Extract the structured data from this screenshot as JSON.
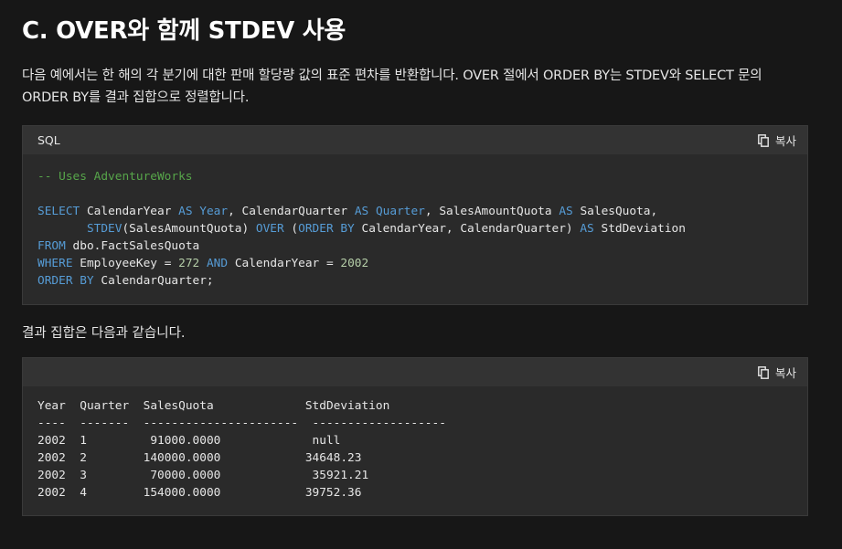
{
  "heading": "C. OVER와 함께 STDEV 사용",
  "description": "다음 예에서는 한 해의 각 분기에 대한 판매 할당량 값의 표준 편차를 반환합니다. OVER 절에서 ORDER BY는 STDEV와 SELECT 문의 ORDER BY를 결과 집합으로 정렬합니다.",
  "sql_block": {
    "language": "SQL",
    "copy_label": "복사",
    "comment": "-- Uses AdventureWorks",
    "line1": {
      "select": "SELECT",
      "col1": "CalendarYear",
      "as1": "AS",
      "alias1": "Year",
      "col2": "CalendarQuarter",
      "as2": "AS",
      "alias2": "Quarter",
      "col3": "SalesAmountQuota",
      "as3": "AS",
      "alias3": "SalesQuota,"
    },
    "line2": {
      "func": "STDEV",
      "arg": "(SalesAmountQuota)",
      "over": "OVER",
      "orderby": "ORDER BY",
      "cols": "CalendarYear, CalendarQuarter)",
      "as": "AS",
      "alias": "StdDeviation"
    },
    "line3": {
      "from": "FROM",
      "table": "dbo.FactSalesQuota"
    },
    "line4": {
      "where": "WHERE",
      "cond1": "EmployeeKey = ",
      "val1": "272",
      "and": "AND",
      "cond2": "CalendarYear = ",
      "val2": "2002"
    },
    "line5": {
      "orderby": "ORDER BY",
      "col": "CalendarQuarter;"
    }
  },
  "result_intro": "결과 집합은 다음과 같습니다.",
  "result_block": {
    "copy_label": "복사",
    "headers": [
      "Year",
      "Quarter",
      "SalesQuota",
      "StdDeviation"
    ],
    "separators": [
      "----",
      "-------",
      "----------------------",
      "-------------------"
    ],
    "rows": [
      [
        "2002",
        "1",
        "91000.0000",
        "null"
      ],
      [
        "2002",
        "2",
        "140000.0000",
        "34648.23"
      ],
      [
        "2002",
        "3",
        "70000.0000",
        "35921.21"
      ],
      [
        "2002",
        "4",
        "154000.0000",
        "39752.36"
      ]
    ]
  }
}
